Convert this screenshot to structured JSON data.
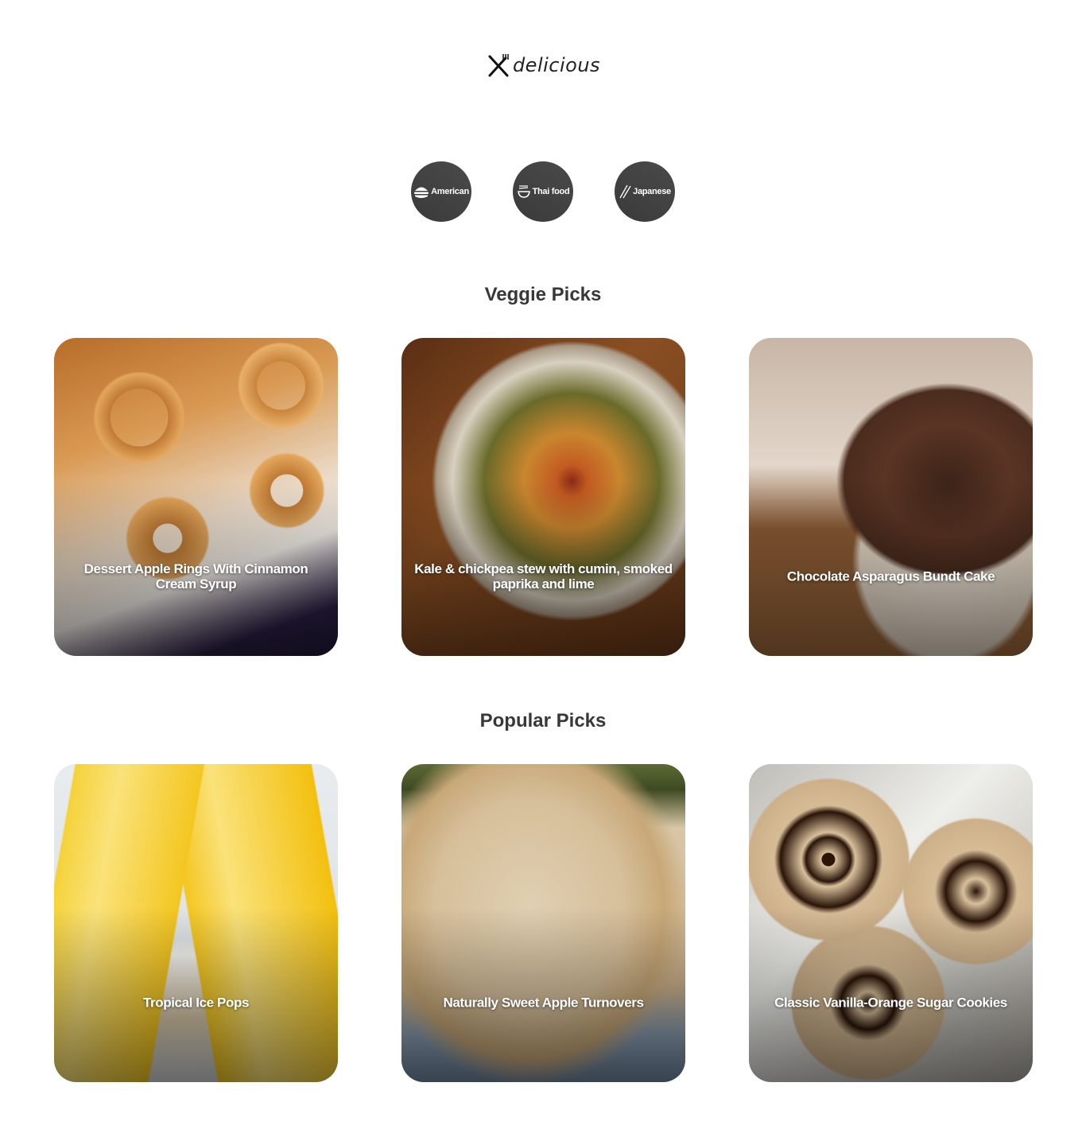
{
  "header": {
    "logo_icon": "fork-knife-icon",
    "logo_text": "delicious"
  },
  "categories": [
    {
      "label": "American",
      "icon": "hamburger-icon"
    },
    {
      "label": "Thai food",
      "icon": "noodle-bowl-icon"
    },
    {
      "label": "Japanese",
      "icon": "chopsticks-icon"
    }
  ],
  "sections": [
    {
      "title": "Veggie Picks",
      "cards": [
        {
          "title": "Dessert Apple Rings With Cinnamon Cream Syrup"
        },
        {
          "title": "Kale & chickpea stew with cumin, smoked paprika and lime"
        },
        {
          "title": "Chocolate Asparagus Bundt Cake"
        }
      ]
    },
    {
      "title": "Popular Picks",
      "cards": [
        {
          "title": "Tropical Ice Pops"
        },
        {
          "title": "Naturally Sweet Apple Turnovers"
        },
        {
          "title": "Classic Vanilla-Orange Sugar Cookies"
        }
      ]
    }
  ],
  "colors": {
    "category_bg": "#3f3f3f",
    "heading": "#383838",
    "caption": "#ffffff"
  }
}
